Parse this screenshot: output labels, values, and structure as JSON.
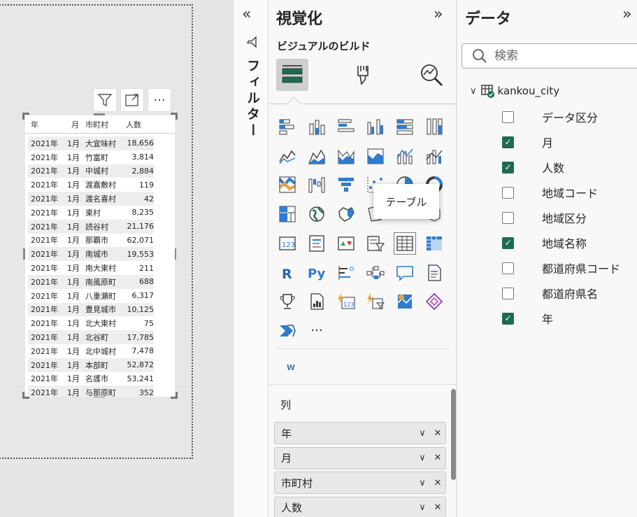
{
  "canvas": {
    "table": {
      "headers": [
        "年",
        "月",
        "市町村",
        "人数"
      ],
      "rows": [
        [
          "2021年",
          "1月",
          "大宜味村",
          "18,656"
        ],
        [
          "2021年",
          "1月",
          "竹富町",
          "3,814"
        ],
        [
          "2021年",
          "1月",
          "中城村",
          "2,884"
        ],
        [
          "2021年",
          "1月",
          "渡嘉敷村",
          "119"
        ],
        [
          "2021年",
          "1月",
          "渡名喜村",
          "42"
        ],
        [
          "2021年",
          "1月",
          "東村",
          "8,235"
        ],
        [
          "2021年",
          "1月",
          "読谷村",
          "21,176"
        ],
        [
          "2021年",
          "1月",
          "那覇市",
          "62,071"
        ],
        [
          "2021年",
          "1月",
          "南城市",
          "19,553"
        ],
        [
          "2021年",
          "1月",
          "南大東村",
          "211"
        ],
        [
          "2021年",
          "1月",
          "南風原町",
          "688"
        ],
        [
          "2021年",
          "1月",
          "八重瀬町",
          "6,317"
        ],
        [
          "2021年",
          "1月",
          "豊見城市",
          "10,125"
        ],
        [
          "2021年",
          "1月",
          "北大東村",
          "75"
        ],
        [
          "2021年",
          "1月",
          "北谷町",
          "17,785"
        ],
        [
          "2021年",
          "1月",
          "北中城村",
          "7,478"
        ],
        [
          "2021年",
          "1月",
          "本部町",
          "52,872"
        ],
        [
          "2021年",
          "1月",
          "名護市",
          "53,241"
        ],
        [
          "2021年",
          "1月",
          "与那原町",
          "352"
        ]
      ]
    },
    "toolbar": {
      "filter_icon": "funnel-icon",
      "focus_icon": "focus-mode-icon",
      "more_label": "···"
    }
  },
  "filters": {
    "collapse_label": "«",
    "label": "フィルター"
  },
  "visualizations": {
    "title": "視覚化",
    "expand_label": "»",
    "build_label": "ビジュアルのビルド",
    "tooltip": "テーブル",
    "more_label": "···",
    "custom_label": "W",
    "columns_label": "列",
    "fields": [
      "年",
      "月",
      "市町村",
      "人数"
    ],
    "field_chevron": "∨",
    "field_remove": "✕"
  },
  "data": {
    "title": "データ",
    "expand_label": "»",
    "search_placeholder": "検索",
    "table_name": "kankou_city",
    "fields": [
      {
        "name": "データ区分",
        "checked": false
      },
      {
        "name": "月",
        "checked": true
      },
      {
        "name": "人数",
        "checked": true
      },
      {
        "name": "地域コード",
        "checked": false
      },
      {
        "name": "地域区分",
        "checked": false
      },
      {
        "name": "地域名称",
        "checked": true
      },
      {
        "name": "都道府県コード",
        "checked": false
      },
      {
        "name": "都道府県名",
        "checked": false
      },
      {
        "name": "年",
        "checked": true
      }
    ],
    "check_color": "#1d6b52"
  }
}
